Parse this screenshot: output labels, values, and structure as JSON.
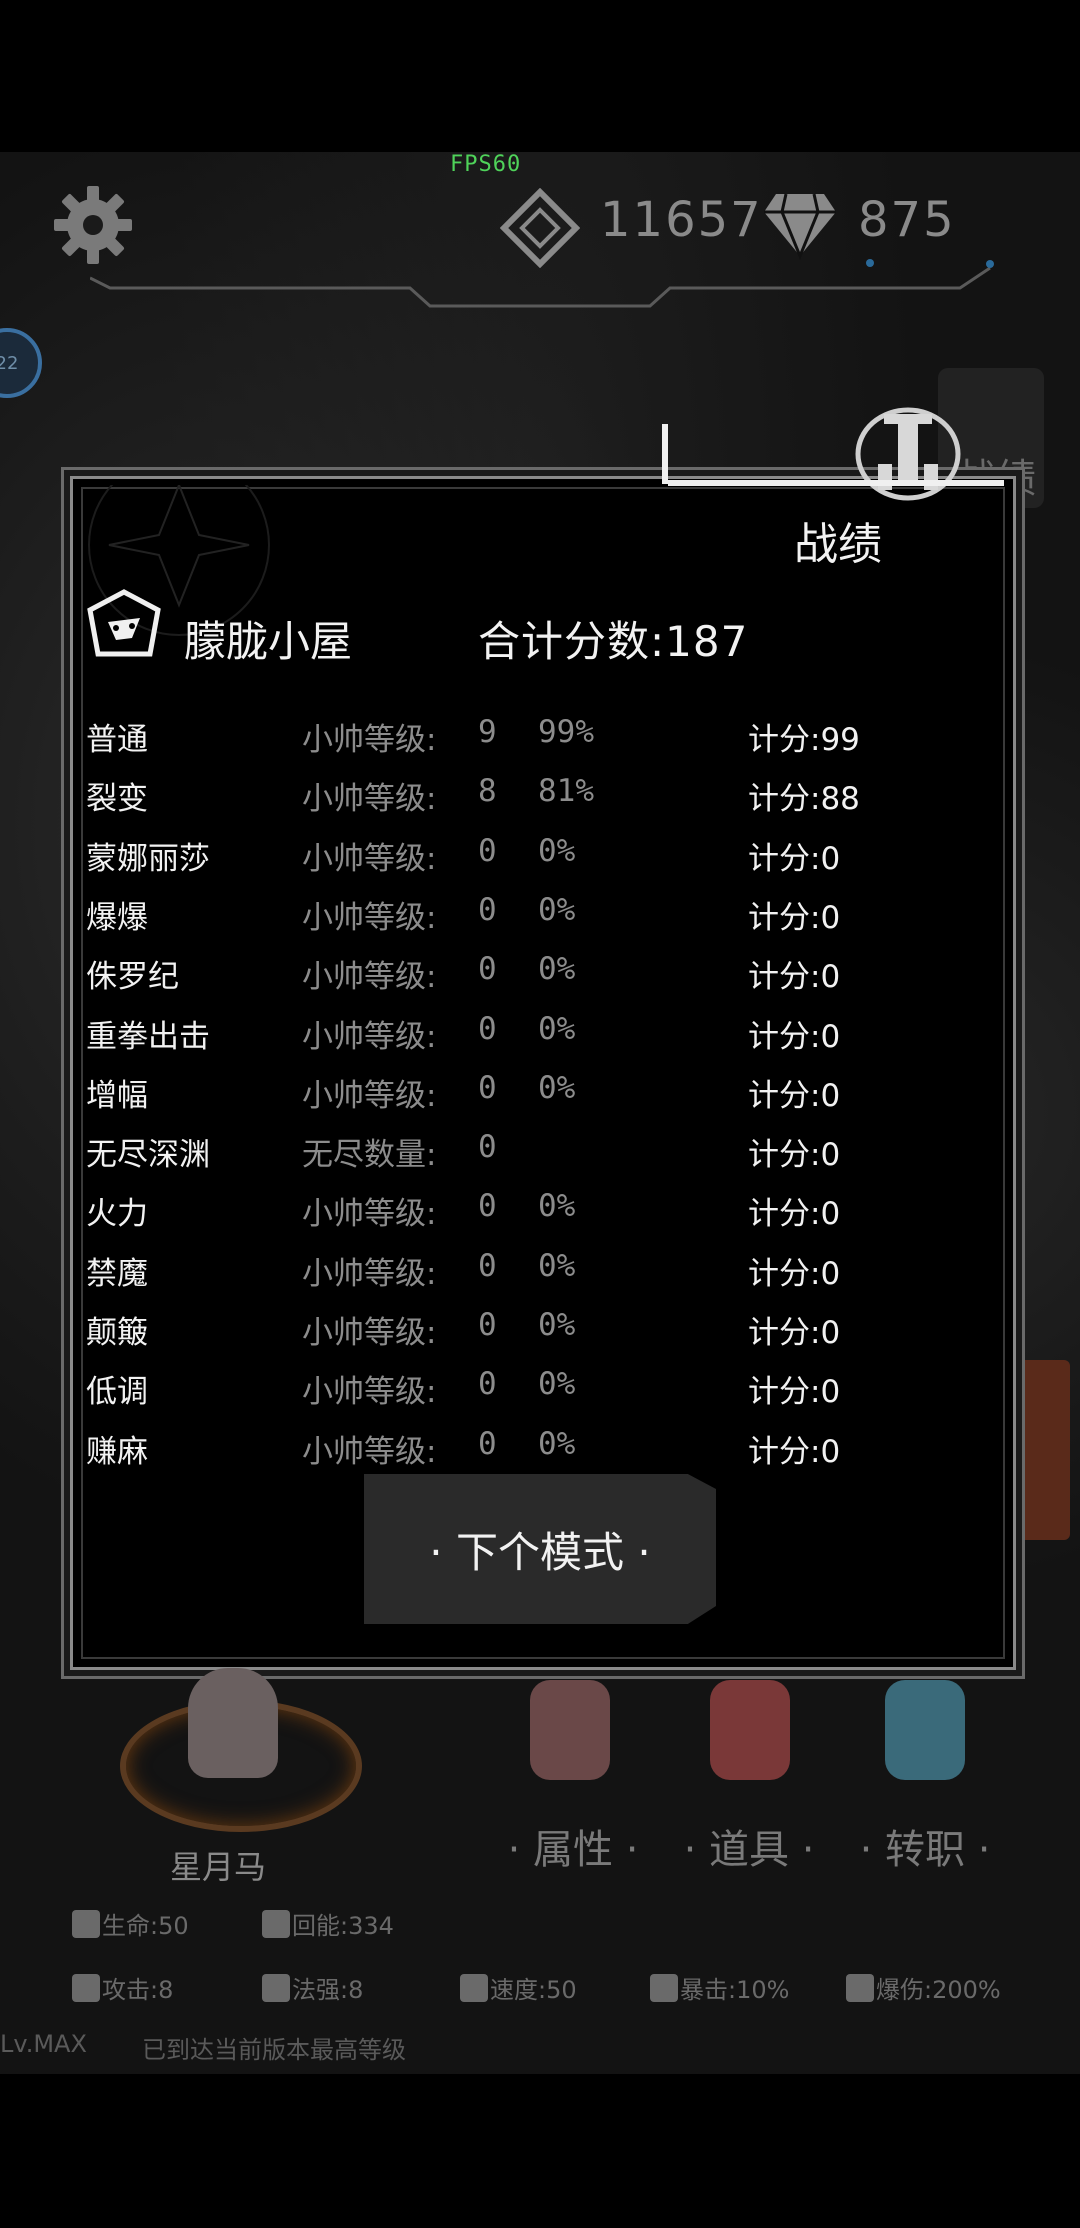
{
  "hud": {
    "fps": "FPS60",
    "crystals": "11657",
    "diamonds": "875",
    "level_badge": "22",
    "side_button": "战绩"
  },
  "modal": {
    "title": "战绩",
    "mode_name": "朦胧小屋",
    "total_score": "合计分数:187",
    "rows": [
      {
        "name": "普通",
        "label": "小帅等级:",
        "level": "9",
        "percent": "99%",
        "score": "计分:99"
      },
      {
        "name": "裂变",
        "label": "小帅等级:",
        "level": "8",
        "percent": "81%",
        "score": "计分:88"
      },
      {
        "name": "蒙娜丽莎",
        "label": "小帅等级:",
        "level": "0",
        "percent": "0%",
        "score": "计分:0"
      },
      {
        "name": "爆爆",
        "label": "小帅等级:",
        "level": "0",
        "percent": "0%",
        "score": "计分:0"
      },
      {
        "name": "侏罗纪",
        "label": "小帅等级:",
        "level": "0",
        "percent": "0%",
        "score": "计分:0"
      },
      {
        "name": "重拳出击",
        "label": "小帅等级:",
        "level": "0",
        "percent": "0%",
        "score": "计分:0"
      },
      {
        "name": "增幅",
        "label": "小帅等级:",
        "level": "0",
        "percent": "0%",
        "score": "计分:0"
      },
      {
        "name": "无尽深渊",
        "label": "无尽数量:",
        "level": "0",
        "percent": "",
        "score": "计分:0"
      },
      {
        "name": "火力",
        "label": "小帅等级:",
        "level": "0",
        "percent": "0%",
        "score": "计分:0"
      },
      {
        "name": "禁魔",
        "label": "小帅等级:",
        "level": "0",
        "percent": "0%",
        "score": "计分:0"
      },
      {
        "name": "颠簸",
        "label": "小帅等级:",
        "level": "0",
        "percent": "0%",
        "score": "计分:0"
      },
      {
        "name": "低调",
        "label": "小帅等级:",
        "level": "0",
        "percent": "0%",
        "score": "计分:0"
      },
      {
        "name": "赚麻",
        "label": "小帅等级:",
        "level": "0",
        "percent": "0%",
        "score": "计分:0"
      }
    ],
    "next_button": "· 下个模式 ·"
  },
  "character": {
    "name": "星月马"
  },
  "tabs": [
    {
      "label": "· 属性 ·"
    },
    {
      "label": "· 道具 ·"
    },
    {
      "label": "· 转职 ·"
    }
  ],
  "stats": {
    "hp": "生命:50",
    "regen": "回能:334",
    "attack": "攻击:8",
    "magic": "法强:8",
    "speed": "速度:50",
    "crit": "暴击:10%",
    "crit_dmg": "爆伤:200%"
  },
  "footer": {
    "level": "Lv.MAX",
    "note": "已到达当前版本最高等级"
  }
}
